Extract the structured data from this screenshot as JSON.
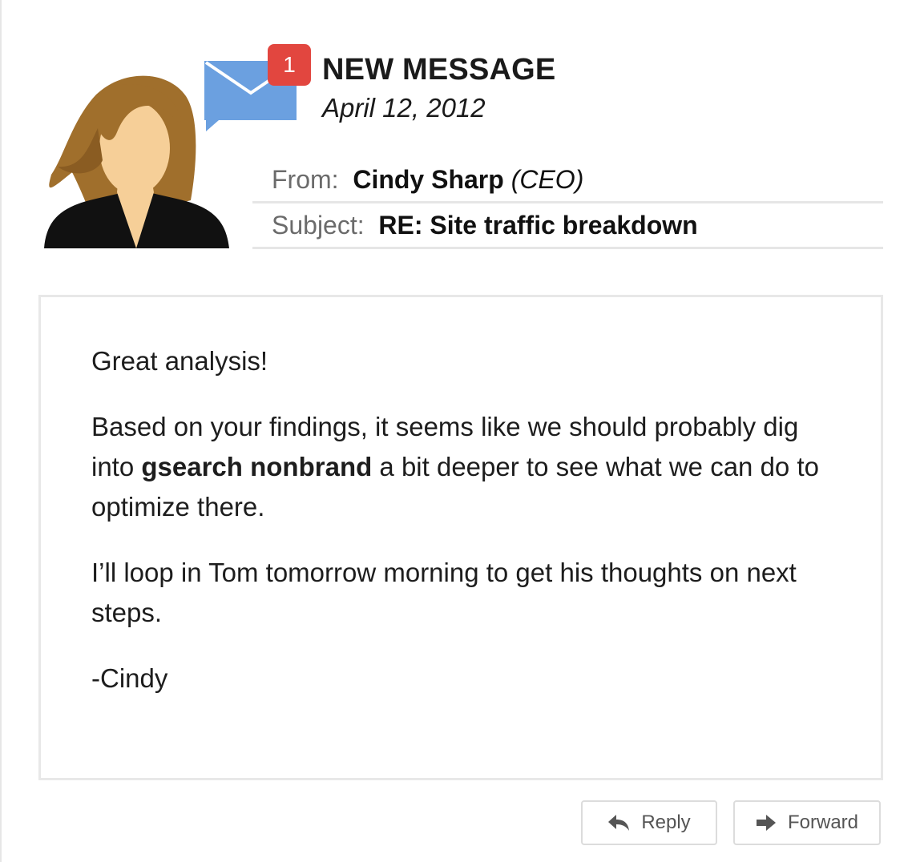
{
  "notification": {
    "badge_count": "1",
    "heading": "NEW MESSAGE",
    "date": "April 12, 2012",
    "icon": "envelope-icon"
  },
  "header": {
    "from_label": "From:",
    "from_name": "Cindy Sharp",
    "from_role": "(CEO)",
    "subject_label": "Subject:",
    "subject_value": "RE: Site traffic breakdown"
  },
  "message": {
    "greeting": "Great analysis!",
    "p1_before": "Based on your findings, it seems like we should probably dig into ",
    "p1_bold": "gsearch nonbrand",
    "p1_after": " a bit deeper to see what we can do to optimize there.",
    "p2": "I’ll loop in Tom tomorrow morning to get his thoughts on next steps.",
    "signature": "-Cindy"
  },
  "actions": {
    "reply_label": "Reply",
    "forward_label": "Forward"
  },
  "colors": {
    "badge": "#e2463f",
    "envelope": "#6ba0e0",
    "hair": "#a06f2c",
    "skin": "#f6cf98",
    "suit": "#111111"
  }
}
